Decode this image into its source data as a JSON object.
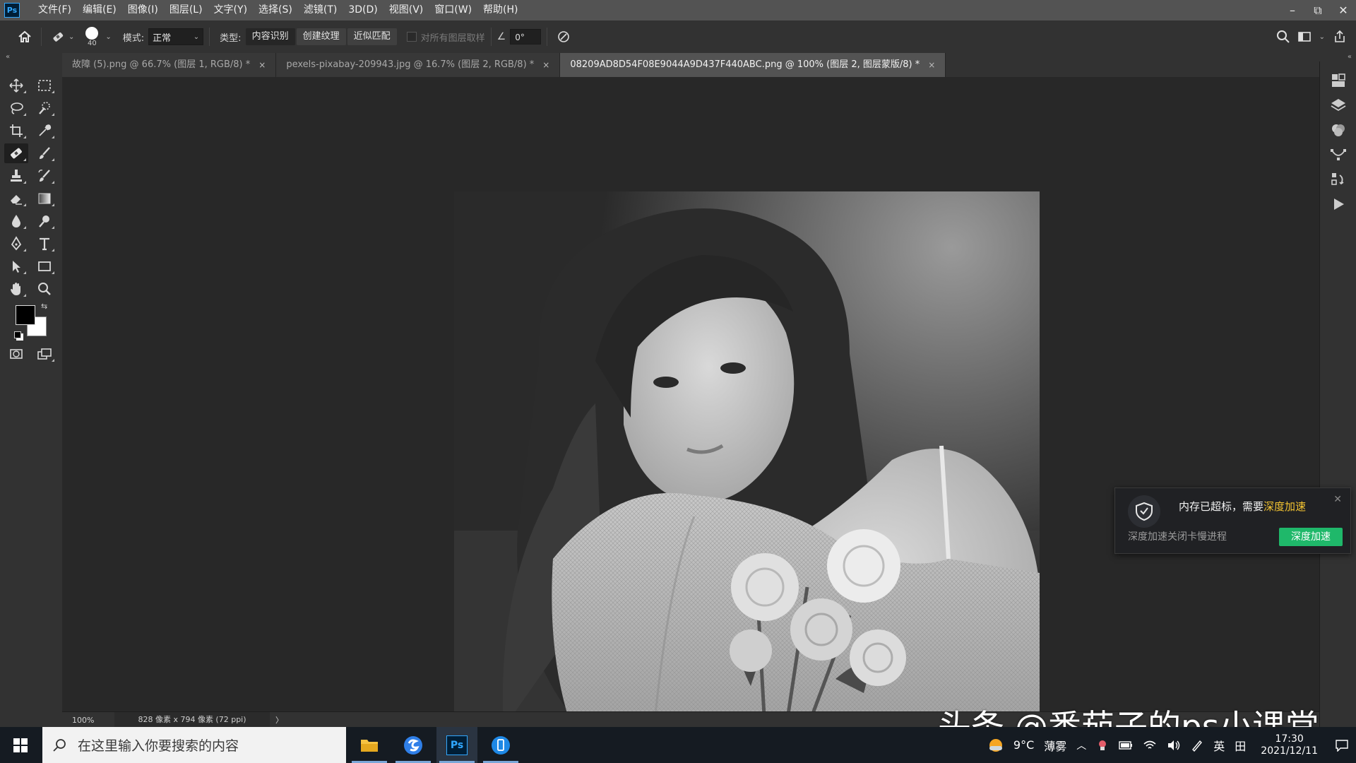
{
  "menubar": {
    "logo": "Ps",
    "items": [
      "文件(F)",
      "编辑(E)",
      "图像(I)",
      "图层(L)",
      "文字(Y)",
      "选择(S)",
      "滤镜(T)",
      "3D(D)",
      "视图(V)",
      "窗口(W)",
      "帮助(H)"
    ],
    "minimize": "–",
    "restore": "⧉",
    "close": "✕"
  },
  "options": {
    "brush_size": "40",
    "mode_label": "模式:",
    "mode_value": "正常",
    "type_label": "类型:",
    "type_options": [
      "内容识别",
      "创建纹理",
      "近似匹配"
    ],
    "sample_all_layers": "对所有图层取样",
    "angle_value": "0°"
  },
  "tabs": [
    {
      "label": "故障 (5).png @ 66.7% (图层 1, RGB/8) *",
      "close": "×"
    },
    {
      "label": "pexels-pixabay-209943.jpg @ 16.7% (图层 2, RGB/8) *",
      "close": "×"
    },
    {
      "label": "08209AD8D54F08E9044A9D437F440ABC.png @ 100% (图层 2, 图层蒙版/8) *",
      "close": "×"
    }
  ],
  "statusbar": {
    "zoom": "100%",
    "doc_info": "828 像素 x 794 像素 (72 ppi)",
    "arrow": "〉"
  },
  "popup": {
    "title_text": "内存已超标，需要",
    "title_highlight": "深度加速",
    "description": "深度加速关闭卡慢进程",
    "button": "深度加速",
    "close": "✕"
  },
  "watermark": "头条 @番茄子的ps小课堂",
  "taskbar": {
    "search_placeholder": "在这里输入你要搜索的内容",
    "weather_temp": "9°C",
    "weather_text": "薄雾",
    "ime_lang": "英",
    "ime_grid": "田",
    "time": "17:30",
    "date": "2021/12/11"
  },
  "colors": {
    "menubar_bg": "#535353",
    "panel_bg": "#323232",
    "canvas_bg": "#282828",
    "accent_green": "#1fb86a",
    "accent_yellow": "#f3c331"
  }
}
